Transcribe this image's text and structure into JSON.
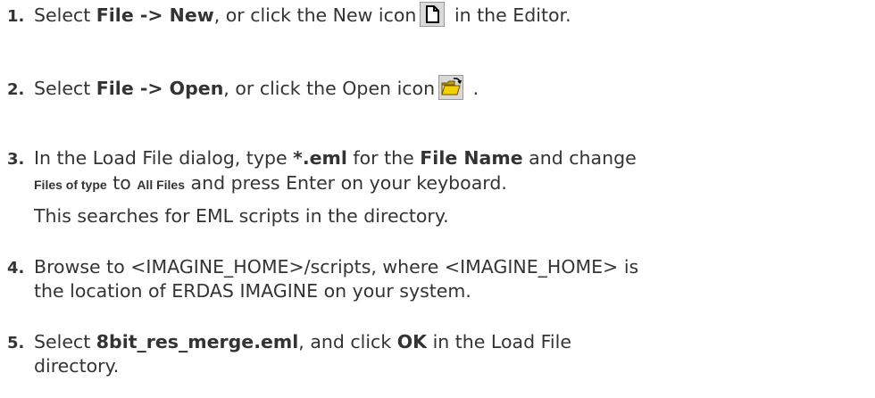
{
  "steps": [
    {
      "num": "1.",
      "t1": "Select ",
      "b1": "File -> New",
      "t2": ", or click the New icon",
      "t3": " in the Editor.",
      "icon": "new-file-icon"
    },
    {
      "num": "2.",
      "t1": "Select ",
      "b1": "File -> Open",
      "t2": ", or click the Open icon",
      "t3": " .",
      "icon": "open-folder-icon"
    },
    {
      "num": "3.",
      "t1": "In the Load File dialog, type ",
      "b1": "*.eml",
      "t2": " for the ",
      "b2": "File Name",
      "t3": " and change",
      "s1": "Files of type",
      "t4": " to ",
      "s2": "All Files",
      "t5": " and press Enter on your keyboard.",
      "note": "This searches for EML scripts in the directory."
    },
    {
      "num": "4.",
      "l1": "Browse to <IMAGINE_HOME>/scripts, where <IMAGINE_HOME> is",
      "l2": "the location of ERDAS IMAGINE on your system."
    },
    {
      "num": "5.",
      "t1": "Select ",
      "b1": "8bit_res_merge.eml",
      "t2": ", and click ",
      "b2": "OK",
      "t3": " in the Load File",
      "l2": "directory."
    }
  ]
}
